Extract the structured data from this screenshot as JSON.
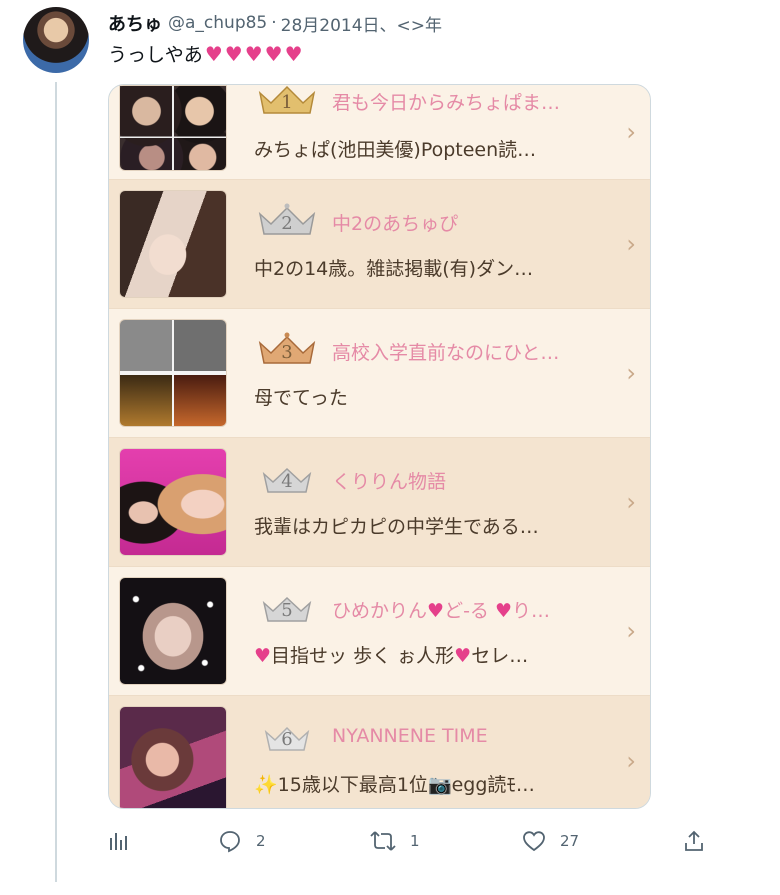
{
  "tweet": {
    "display_name": "あちゅ",
    "handle": "@a_chup85",
    "separator": "·",
    "date": "28月2014日、<>年",
    "text": "うっしやあ"
  },
  "ranking": [
    {
      "rank": "1",
      "crown": "gold",
      "title": "君も今日からみちょぱま…",
      "desc": "みちょぱ(池田美優)Popteen読…"
    },
    {
      "rank": "2",
      "crown": "silver",
      "title": "中2のあちゅぴ",
      "desc": "中2の14歳。雑誌掲載(有)ダン…"
    },
    {
      "rank": "3",
      "crown": "bronze",
      "title": "高校入学直前なのにひと…",
      "desc": "母でてった"
    },
    {
      "rank": "4",
      "crown": "silver",
      "title": "くりりん物語",
      "desc": "我輩はカピカピの中学生である…"
    },
    {
      "rank": "5",
      "crown": "silver",
      "title_a": "ひめかりん",
      "title_b": "ど-る",
      "title_c": "り…",
      "desc_a": "目指せッ 歩く ぉ人形",
      "desc_b": "セレ…"
    },
    {
      "rank": "6",
      "crown": "silver",
      "title": "NYANNENE TIME",
      "desc_a": "15歳以下最高1位",
      "desc_b": "egg読ﾓ…"
    }
  ],
  "actions": {
    "replies": "2",
    "retweets": "1",
    "likes": "27"
  },
  "colors": {
    "accent_pink": "#e5408b",
    "title_pink": "#e58aa6",
    "card_bg": "#fbf2e6"
  }
}
